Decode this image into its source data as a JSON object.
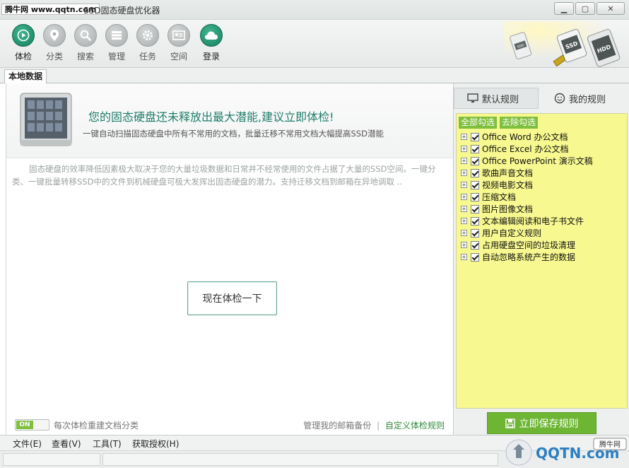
{
  "window": {
    "watermark": "腾牛网 www.qqtn.com",
    "title": "SSD固态硬盘优化器",
    "controls": {
      "minimize": "▁",
      "maximize": "▢",
      "close": "✕"
    }
  },
  "toolbar": {
    "items": [
      {
        "label": "体检",
        "icon": "play-icon",
        "active": true
      },
      {
        "label": "分类",
        "icon": "location-pin-icon"
      },
      {
        "label": "搜索",
        "icon": "search-icon"
      },
      {
        "label": "管理",
        "icon": "list-icon"
      },
      {
        "label": "任务",
        "icon": "gear-icon"
      },
      {
        "label": "空间",
        "icon": "id-card-icon"
      },
      {
        "label": "登录",
        "icon": "cloud-icon"
      }
    ],
    "badge_ssd": "SSD",
    "badge_hdd": "HDD"
  },
  "tabs": {
    "local_data": "本地数据"
  },
  "main": {
    "banner_title": "您的固态硬盘还未释放出最大潜能,建议立即体检!",
    "banner_subtitle": "一键自动扫描固态硬盘中所有不常用的文档，批量迁移不常用文档大幅提高SSD潜能",
    "description": "固态硬盘的效率降低因素极大取决于您的大量垃圾数据和日常并不经常使用的文件占据了大量的SSD空间。一键分类、一键批量转移SSD中的文件到机械硬盘可极大发挥出固态硬盘的潜力。支持迁移文档到邮箱在异地调取 ..",
    "check_button": "现在体检一下",
    "toggle_state": "ON",
    "toggle_label": "每次体检重建文档分类",
    "link_manage_mail": "管理我的邮箱备份",
    "link_separator": "|",
    "link_custom_rules": "自定义体检规则"
  },
  "right_panel": {
    "tab_default": "默认规则",
    "tab_mine": "我的规则",
    "select_all": "全部勾选",
    "deselect_all": "去除勾选",
    "rules": [
      "Office Word 办公文档",
      "Office Excel 办公文档",
      "Office PowerPoint 演示文稿",
      "歌曲声音文档",
      "视频电影文档",
      "压缩文档",
      "图片图像文档",
      "文本编辑阅读和电子书文件",
      "用户自定义规则",
      "占用硬盘空间的垃圾清理",
      "自动忽略系统产生的数据"
    ],
    "save_button": "立即保存规则"
  },
  "menubar": {
    "file": "文件(E)",
    "view": "查看(V)",
    "tools": "工具(T)",
    "license": "获取授权(H)"
  },
  "watermark_br": {
    "site": "QQTN.com",
    "brand": "腾牛网"
  },
  "colors": {
    "accent": "#1f7e6a",
    "green": "#6db533",
    "rules_bg": "#f7f88f"
  }
}
